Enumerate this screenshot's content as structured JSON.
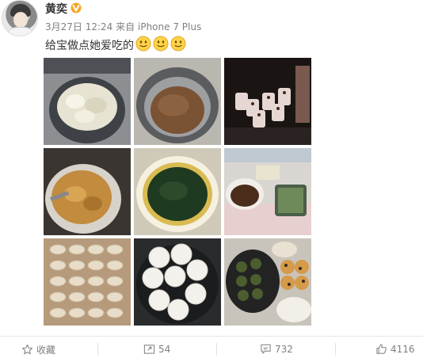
{
  "user": {
    "name": "黄奕",
    "verified_icon": "verified-v-icon"
  },
  "post": {
    "date": "3月27日",
    "time": "12:24",
    "via": "来自",
    "device": "iPhone 7 Plus",
    "text": "给宝做点她爱吃的",
    "emoji": [
      "smile-emoji",
      "smile-emoji",
      "smile-emoji"
    ]
  },
  "photos": [
    {
      "name": "photo-dough-in-pot"
    },
    {
      "name": "photo-meat-filling"
    },
    {
      "name": "photo-cupcakes-oven"
    },
    {
      "name": "photo-golden-filling"
    },
    {
      "name": "photo-green-sauce"
    },
    {
      "name": "photo-prep-table"
    },
    {
      "name": "photo-dumplings-tray"
    },
    {
      "name": "photo-steamed-buns"
    },
    {
      "name": "photo-green-dumplings-cupcakes"
    }
  ],
  "actions": {
    "favorite": {
      "label": "收藏",
      "icon": "star-icon"
    },
    "repost": {
      "count": "54",
      "icon": "repost-icon"
    },
    "comment": {
      "count": "732",
      "icon": "comment-icon"
    },
    "like": {
      "count": "4116",
      "icon": "thumbs-up-icon"
    }
  },
  "colors": {
    "accent_text": "#333333",
    "meta_text": "#808080",
    "verified": "#f6a623"
  }
}
